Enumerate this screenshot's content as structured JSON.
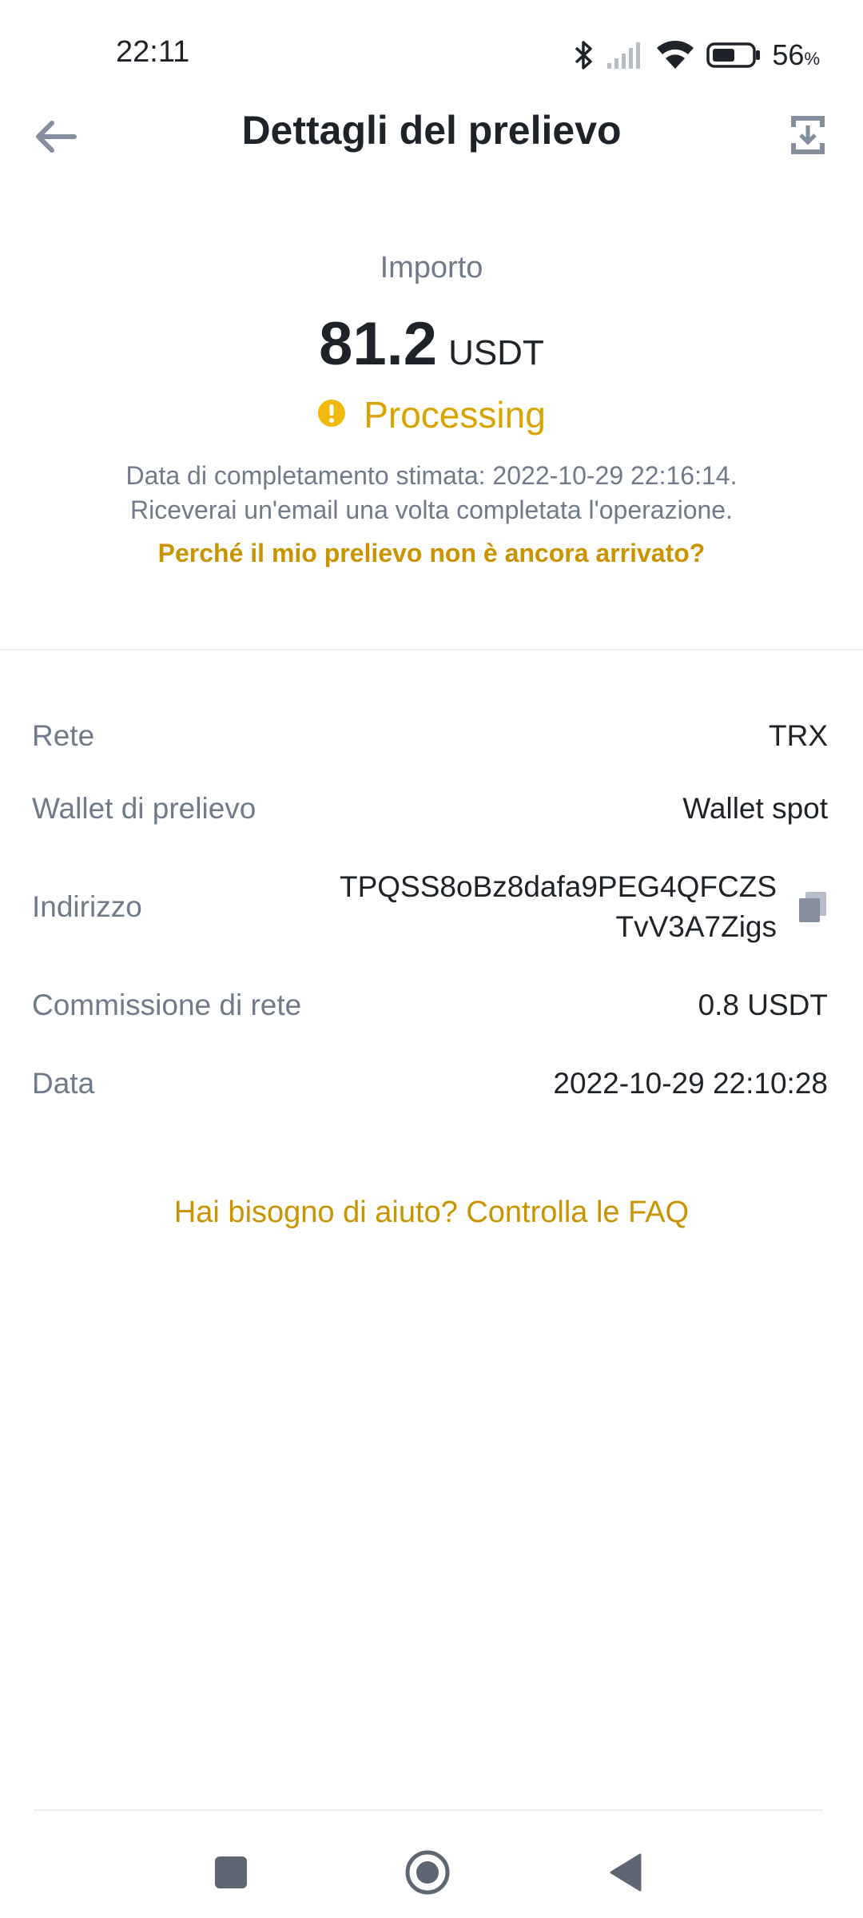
{
  "status_bar": {
    "time": "22:11",
    "battery_percent": "56",
    "battery_unit": "%",
    "icons": [
      "bluetooth-icon",
      "signal-icon",
      "wifi-icon",
      "battery-icon"
    ]
  },
  "header": {
    "title": "Dettagli del prelievo",
    "back_icon": "arrow-left-icon",
    "export_icon": "export-download-icon"
  },
  "summary": {
    "amount_label": "Importo",
    "amount_value": "81.2",
    "amount_unit": "USDT",
    "status": "Processing",
    "status_icon": "alert-circle-icon",
    "eta_line1": "Data di completamento stimata: 2022-10-29 22:16:14.",
    "eta_line2": "Riceverai un'email una volta completata l'operazione.",
    "help_link": "Perché il mio prelievo non è ancora arrivato?"
  },
  "details": {
    "network_label": "Rete",
    "network_value": "TRX",
    "wallet_label": "Wallet di prelievo",
    "wallet_value": "Wallet spot",
    "address_label": "Indirizzo",
    "address_line1": "TPQSS8oBz8dafa9PEG4QFCZS",
    "address_line2": "TvV3A7Zigs",
    "fee_label": "Commissione di rete",
    "fee_value": "0.8 USDT",
    "date_label": "Data",
    "date_value": "2022-10-29 22:10:28"
  },
  "faq_link": "Hai bisogno di aiuto? Controlla le FAQ",
  "colors": {
    "accent": "#c99400",
    "status": "#d9a400",
    "text_primary": "#1e2329",
    "text_secondary": "#707a8a"
  }
}
